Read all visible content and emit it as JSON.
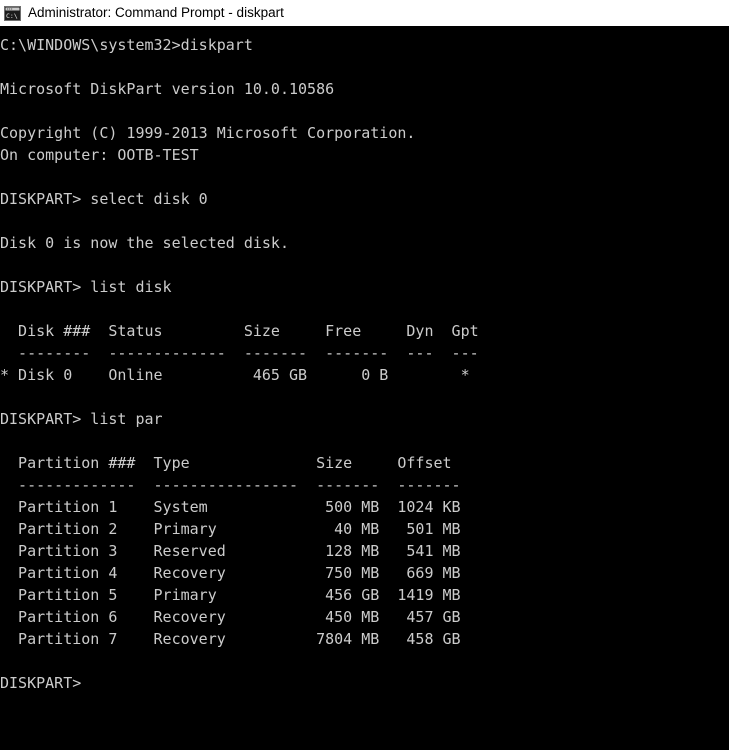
{
  "window": {
    "title": "Administrator: Command Prompt - diskpart",
    "icon": "command-prompt-icon",
    "background_color": "#000000",
    "titlebar_color": "#ffffff",
    "text_color": "#cccccc"
  },
  "console": {
    "lines": [
      "C:\\WINDOWS\\system32>diskpart",
      "",
      "Microsoft DiskPart version 10.0.10586",
      "",
      "Copyright (C) 1999-2013 Microsoft Corporation.",
      "On computer: OOTB-TEST",
      "",
      "DISKPART> select disk 0",
      "",
      "Disk 0 is now the selected disk.",
      "",
      "DISKPART> list disk",
      "",
      "  Disk ###  Status         Size     Free     Dyn  Gpt",
      "  --------  -------------  -------  -------  ---  ---",
      "* Disk 0    Online          465 GB      0 B        *",
      "",
      "DISKPART> list par",
      "",
      "  Partition ###  Type              Size     Offset",
      "  -------------  ----------------  -------  -------",
      "  Partition 1    System             500 MB  1024 KB",
      "  Partition 2    Primary             40 MB   501 MB",
      "  Partition 3    Reserved           128 MB   541 MB",
      "  Partition 4    Recovery           750 MB   669 MB",
      "  Partition 5    Primary            456 GB  1419 MB",
      "  Partition 6    Recovery           450 MB   457 GB",
      "  Partition 7    Recovery          7804 MB   458 GB",
      "",
      "DISKPART>"
    ],
    "prompt_current": "DISKPART>",
    "shell_prompt": "C:\\WINDOWS\\system32>",
    "commands_entered": [
      "diskpart",
      "select disk 0",
      "list disk",
      "list par"
    ],
    "version_line": "Microsoft DiskPart version 10.0.10586",
    "copyright_line": "Copyright (C) 1999-2013 Microsoft Corporation.",
    "computer_line": "On computer: OOTB-TEST",
    "select_result": "Disk 0 is now the selected disk."
  },
  "disk_table": {
    "headers": [
      "Disk ###",
      "Status",
      "Size",
      "Free",
      "Dyn",
      "Gpt"
    ],
    "rows": [
      {
        "selected_marker": "*",
        "disk": "Disk 0",
        "status": "Online",
        "size": "465 GB",
        "free": "0 B",
        "dyn": "",
        "gpt": "*"
      }
    ]
  },
  "partition_table": {
    "headers": [
      "Partition ###",
      "Type",
      "Size",
      "Offset"
    ],
    "rows": [
      {
        "partition": "Partition 1",
        "type": "System",
        "size": "500 MB",
        "offset": "1024 KB"
      },
      {
        "partition": "Partition 2",
        "type": "Primary",
        "size": "40 MB",
        "offset": "501 MB"
      },
      {
        "partition": "Partition 3",
        "type": "Reserved",
        "size": "128 MB",
        "offset": "541 MB"
      },
      {
        "partition": "Partition 4",
        "type": "Recovery",
        "size": "750 MB",
        "offset": "669 MB"
      },
      {
        "partition": "Partition 5",
        "type": "Primary",
        "size": "456 GB",
        "offset": "1419 MB"
      },
      {
        "partition": "Partition 6",
        "type": "Recovery",
        "size": "450 MB",
        "offset": "457 GB"
      },
      {
        "partition": "Partition 7",
        "type": "Recovery",
        "size": "7804 MB",
        "offset": "458 GB"
      }
    ]
  }
}
